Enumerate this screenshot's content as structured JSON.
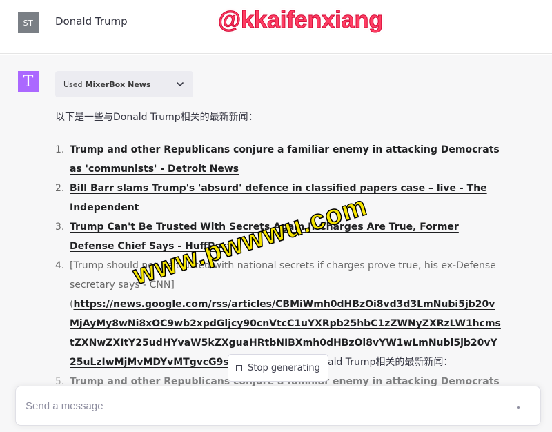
{
  "user": {
    "avatar_initials": "ST",
    "message": "Donald Trump"
  },
  "watermark_top": "@kkaifenxiang",
  "watermark_diagonal": "www.pwwwu.com",
  "assistant": {
    "avatar_letter": "T",
    "plugin_used_prefix": "Used",
    "plugin_name": "MixerBox News",
    "intro": "以下是一些与Donald Trump相关的最新新闻：",
    "items": [
      {
        "num": "1.",
        "text": "Trump and other Republicans conjure a familiar enemy in attacking Democrats as 'communists' - Detroit News"
      },
      {
        "num": "2.",
        "text": "Bill Barr slams Trump's 'absurd' defence in classified papers case – live - The Independent"
      },
      {
        "num": "3.",
        "text": "Trump Can't Be Trusted With Secrets Again If Charges Are True, Former Defense Chief Says - HuffPost"
      },
      {
        "num": "4.",
        "text_plain": "[Trump should not be trusted with national secrets if charges prove true, his ex-Defense secretary says - CNN]",
        "url_open": "(",
        "url": "https://news.google.com/rss/articles/CBMiWmh0dHBzOi8vd3d3LmNubi5jb20vMjAyMy8wNi8xOC9wb2xpdGljcy90cnVtcC1uYXRpb25hbC1zZWNyZXRzLW1hcmstZXNwZXItY25udHYvaW5kZXguaHRtbNIBXmh0dHBzOi8vYW1wLmNubi5jb20vY25uLzIwMjMvMDYvMTgvcG9saXR",
        "tail": "以下是一些与Donald Trump相关的最新新闻："
      },
      {
        "num": "5.",
        "text": "Trump and other Republicans conjure a familiar enemy in attacking Democrats as"
      }
    ],
    "stop_label": "Stop generating"
  },
  "composer": {
    "placeholder": "Send a message"
  }
}
